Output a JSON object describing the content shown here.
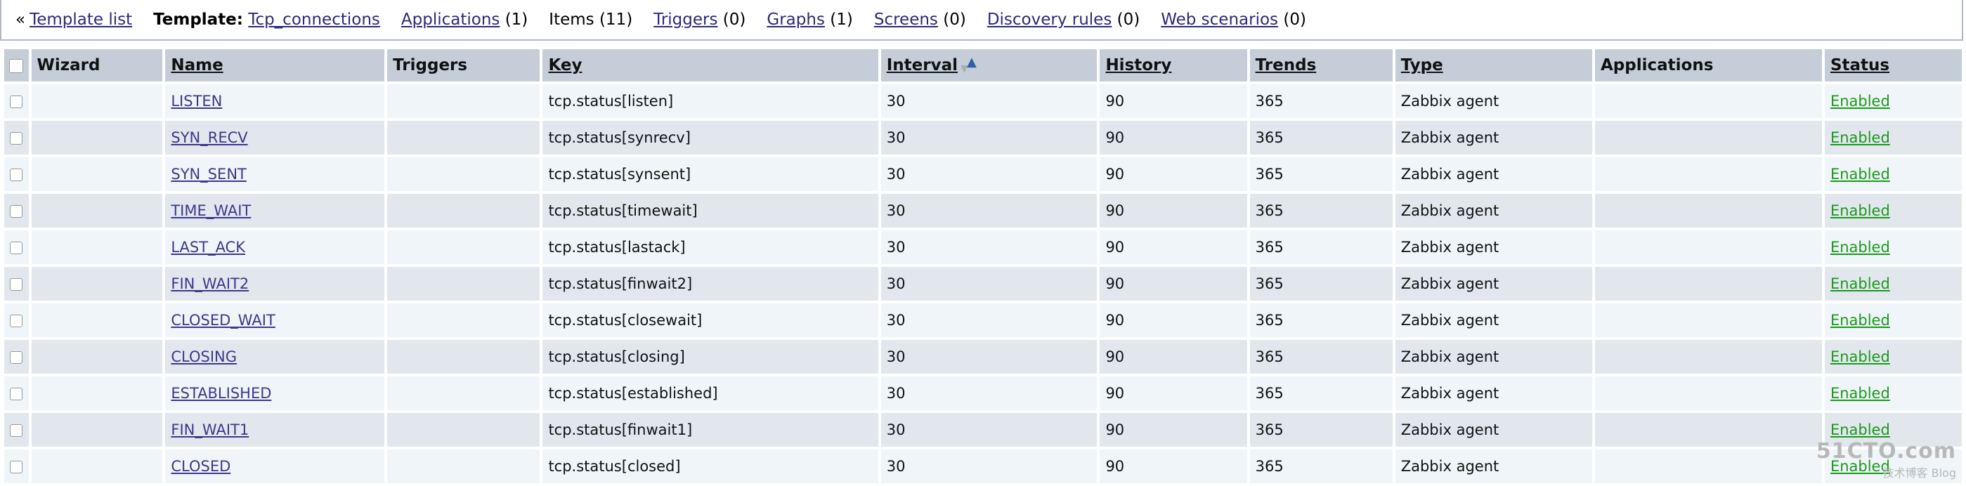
{
  "nav": {
    "back_prefix": "«",
    "template_list": "Template list",
    "template_label": "Template:",
    "template_name": "Tcp_connections",
    "applications": "Applications",
    "applications_count": "(1)",
    "items": "Items",
    "items_count": "(11)",
    "triggers": "Triggers",
    "triggers_count": "(0)",
    "graphs": "Graphs",
    "graphs_count": "(1)",
    "screens": "Screens",
    "screens_count": "(0)",
    "discovery": "Discovery rules",
    "discovery_count": "(0)",
    "web": "Web scenarios",
    "web_count": "(0)"
  },
  "table": {
    "headers": {
      "wizard": "Wizard",
      "name": "Name",
      "triggers": "Triggers",
      "key": "Key",
      "interval": "Interval",
      "history": "History",
      "trends": "Trends",
      "type": "Type",
      "applications": "Applications",
      "status": "Status"
    },
    "sort_icon": "sort-ascending-icon",
    "rows": [
      {
        "name": "LISTEN",
        "key": "tcp.status[listen]",
        "interval": "30",
        "history": "90",
        "trends": "365",
        "type": "Zabbix agent",
        "status": "Enabled"
      },
      {
        "name": "SYN_RECV",
        "key": "tcp.status[synrecv]",
        "interval": "30",
        "history": "90",
        "trends": "365",
        "type": "Zabbix agent",
        "status": "Enabled"
      },
      {
        "name": "SYN_SENT",
        "key": "tcp.status[synsent]",
        "interval": "30",
        "history": "90",
        "trends": "365",
        "type": "Zabbix agent",
        "status": "Enabled"
      },
      {
        "name": "TIME_WAIT",
        "key": "tcp.status[timewait]",
        "interval": "30",
        "history": "90",
        "trends": "365",
        "type": "Zabbix agent",
        "status": "Enabled"
      },
      {
        "name": "LAST_ACK",
        "key": "tcp.status[lastack]",
        "interval": "30",
        "history": "90",
        "trends": "365",
        "type": "Zabbix agent",
        "status": "Enabled"
      },
      {
        "name": "FIN_WAIT2",
        "key": "tcp.status[finwait2]",
        "interval": "30",
        "history": "90",
        "trends": "365",
        "type": "Zabbix agent",
        "status": "Enabled"
      },
      {
        "name": "CLOSED_WAIT",
        "key": "tcp.status[closewait]",
        "interval": "30",
        "history": "90",
        "trends": "365",
        "type": "Zabbix agent",
        "status": "Enabled"
      },
      {
        "name": "CLOSING",
        "key": "tcp.status[closing]",
        "interval": "30",
        "history": "90",
        "trends": "365",
        "type": "Zabbix agent",
        "status": "Enabled"
      },
      {
        "name": "ESTABLISHED",
        "key": "tcp.status[established]",
        "interval": "30",
        "history": "90",
        "trends": "365",
        "type": "Zabbix agent",
        "status": "Enabled"
      },
      {
        "name": "FIN_WAIT1",
        "key": "tcp.status[finwait1]",
        "interval": "30",
        "history": "90",
        "trends": "365",
        "type": "Zabbix agent",
        "status": "Enabled"
      },
      {
        "name": "CLOSED",
        "key": "tcp.status[closed]",
        "interval": "30",
        "history": "90",
        "trends": "365",
        "type": "Zabbix agent",
        "status": "Enabled"
      }
    ]
  },
  "watermark": {
    "line1": "51CTO.com",
    "line2": "技术博客",
    "line3": "Blog"
  },
  "colors": {
    "header_bg": "#c5ced8",
    "row_odd": "#eff5f8",
    "row_even": "#e2e7ee",
    "link": "#3a3a8a",
    "status_enabled": "#1a9a1a"
  }
}
